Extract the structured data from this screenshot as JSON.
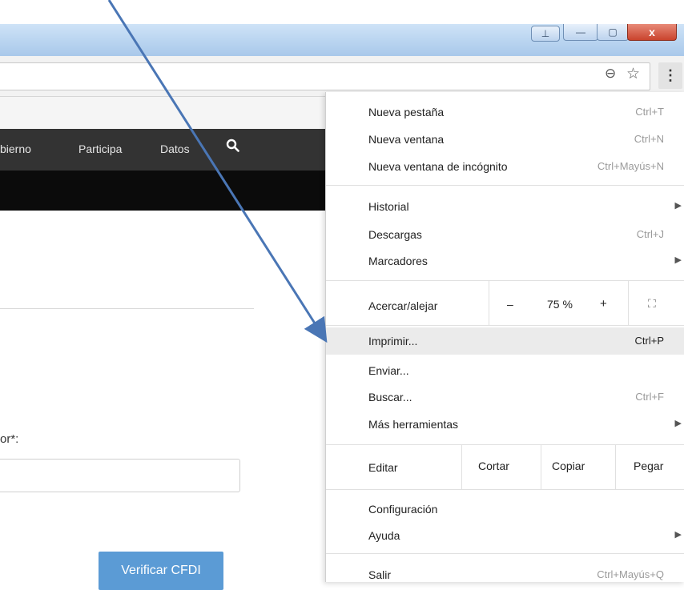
{
  "window": {
    "close_glyph": "x",
    "min_glyph": "—",
    "max_glyph": "▢",
    "user_glyph": "⊥"
  },
  "toolbar": {
    "zoom_glyph": "⊖",
    "star_glyph": "☆",
    "menu_glyph": "⋮"
  },
  "nav": {
    "gobierno": "bierno",
    "participa": "Participa",
    "datos": "Datos",
    "search_glyph": "🔍"
  },
  "form": {
    "field_label": "or*:",
    "input_value": "",
    "verify_button": "Verificar CFDI"
  },
  "menu": {
    "new_tab": "Nueva pestaña",
    "new_tab_sc": "Ctrl+T",
    "new_window": "Nueva ventana",
    "new_window_sc": "Ctrl+N",
    "incognito": "Nueva ventana de incógnito",
    "incognito_sc": "Ctrl+Mayús+N",
    "history": "Historial",
    "downloads": "Descargas",
    "downloads_sc": "Ctrl+J",
    "bookmarks": "Marcadores",
    "zoom_label": "Acercar/alejar",
    "zoom_minus": "–",
    "zoom_value": "75 %",
    "zoom_plus": "+",
    "fullscreen_glyph": "⛶",
    "print": "Imprimir...",
    "print_sc": "Ctrl+P",
    "send": "Enviar...",
    "find": "Buscar...",
    "find_sc": "Ctrl+F",
    "more_tools": "Más herramientas",
    "edit": "Editar",
    "cut": "Cortar",
    "copy": "Copiar",
    "paste": "Pegar",
    "settings": "Configuración",
    "help": "Ayuda",
    "exit": "Salir",
    "exit_sc": "Ctrl+Mayús+Q",
    "submenu_glyph": "▶"
  },
  "colors": {
    "accent_button": "#5b9bd5",
    "annotation_arrow": "#4a76b5",
    "menu_highlight": "#ebebeb"
  }
}
